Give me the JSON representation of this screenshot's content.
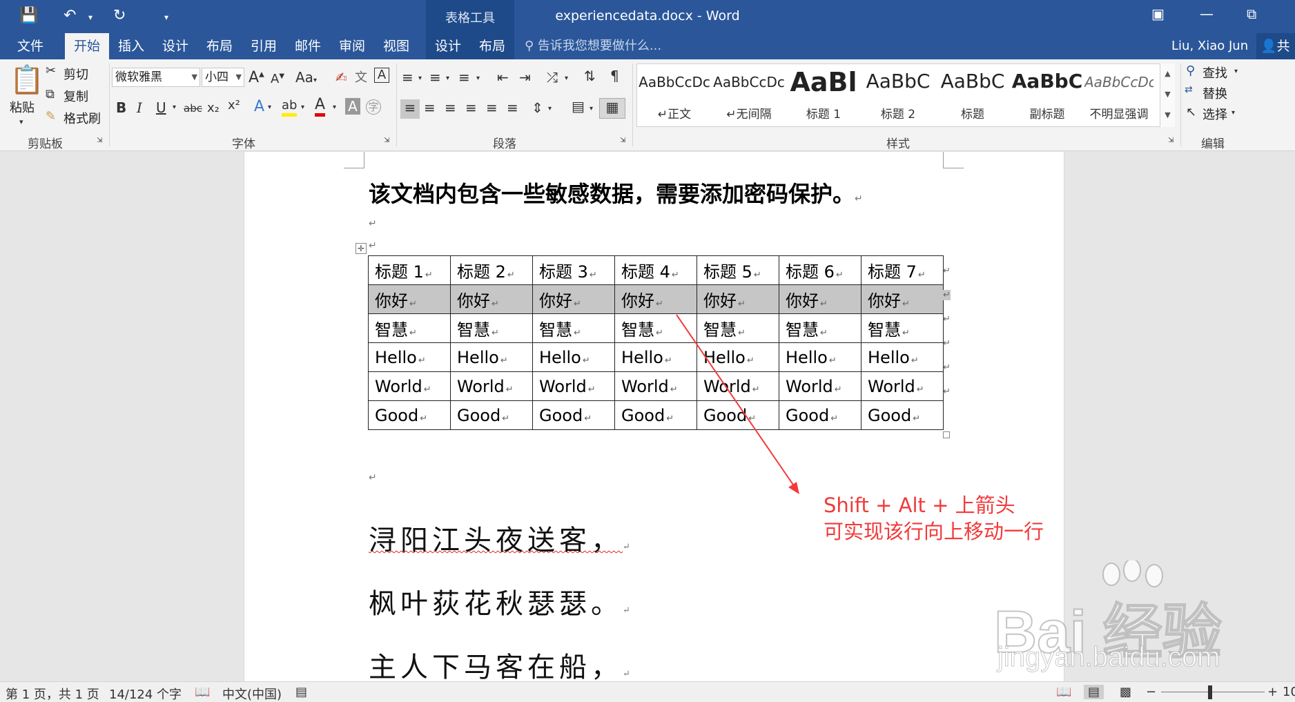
{
  "window": {
    "title": "experiencedata.docx - Word",
    "contextual_group": "表格工具"
  },
  "tabs": [
    {
      "label": "文件"
    },
    {
      "label": "开始"
    },
    {
      "label": "插入"
    },
    {
      "label": "设计"
    },
    {
      "label": "布局"
    },
    {
      "label": "引用"
    },
    {
      "label": "邮件"
    },
    {
      "label": "审阅"
    },
    {
      "label": "视图"
    },
    {
      "label": "设计"
    },
    {
      "label": "布局"
    }
  ],
  "tell_me": "告诉我您想要做什么...",
  "user": {
    "name": "Liu, Xiao Jun",
    "share": "共"
  },
  "ribbon": {
    "clipboard": {
      "paste": "粘贴",
      "cut": "剪切",
      "copy": "复制",
      "format_painter": "格式刷",
      "label": "剪贴板"
    },
    "font": {
      "font_name": "微软雅黑",
      "font_size": "小四",
      "label": "字体",
      "bold": "B",
      "italic": "I",
      "underline": "U",
      "strikethrough": "abc",
      "subscript": "x₂",
      "superscript": "x²",
      "clear": "A",
      "case": "Aa",
      "grow": "A",
      "shrink": "A",
      "phonetic": "文",
      "border_char": "A",
      "effects": "A",
      "highlight": "ab",
      "color": "A",
      "shading": "A",
      "enclose": "字"
    },
    "paragraph": {
      "label": "段落"
    },
    "styles": {
      "label": "样式",
      "items": [
        {
          "sample": "AaBbCcDc",
          "name": "正文"
        },
        {
          "sample": "AaBbCcDc",
          "name": "无间隔"
        },
        {
          "sample": "AaBl",
          "name": "标题 1"
        },
        {
          "sample": "AaBbC",
          "name": "标题 2"
        },
        {
          "sample": "AaBbC",
          "name": "标题"
        },
        {
          "sample": "AaBbC",
          "name": "副标题"
        },
        {
          "sample": "AaBbCcDc",
          "name": "不明显强调"
        }
      ]
    },
    "editing": {
      "find": "查找",
      "replace": "替换",
      "select": "选择",
      "label": "编辑"
    }
  },
  "document": {
    "heading": "该文档内包含一些敏感数据，需要添加密码保护。",
    "table": {
      "rows": [
        [
          "标题 1",
          "标题 2",
          "标题 3",
          "标题 4",
          "标题 5",
          "标题 6",
          "标题 7"
        ],
        [
          "你好",
          "你好",
          "你好",
          "你好",
          "你好",
          "你好",
          "你好"
        ],
        [
          "智慧",
          "智慧",
          "智慧",
          "智慧",
          "智慧",
          "智慧",
          "智慧"
        ],
        [
          "Hello",
          "Hello",
          "Hello",
          "Hello",
          "Hello",
          "Hello",
          "Hello"
        ],
        [
          "World",
          "World",
          "World",
          "World",
          "World",
          "World",
          "World"
        ],
        [
          "Good",
          "Good",
          "Good",
          "Good",
          "Good",
          "Good",
          "Good"
        ]
      ],
      "selected_row": 1
    },
    "poem": [
      "浔阳江头夜送客，",
      "枫叶荻花秋瑟瑟。",
      "主人下马客在船，"
    ],
    "annotation": {
      "line1": "Shift + Alt + 上箭头",
      "line2": "可实现该行向上移动一行",
      "color": "#f23a3a"
    }
  },
  "watermark": {
    "text": "Bai 经验",
    "sub": "jingyan.baidu.com"
  },
  "statusbar": {
    "page": "第 1 页，共 1 页",
    "words": "14/124 个字",
    "language": "中文(中国)",
    "zoom_minus": "−",
    "zoom_plus": "+",
    "zoom_value": "10"
  },
  "colors": {
    "brand": "#2b579a",
    "ribbon": "#f3f3f3",
    "selection": "#c6c6c6"
  }
}
